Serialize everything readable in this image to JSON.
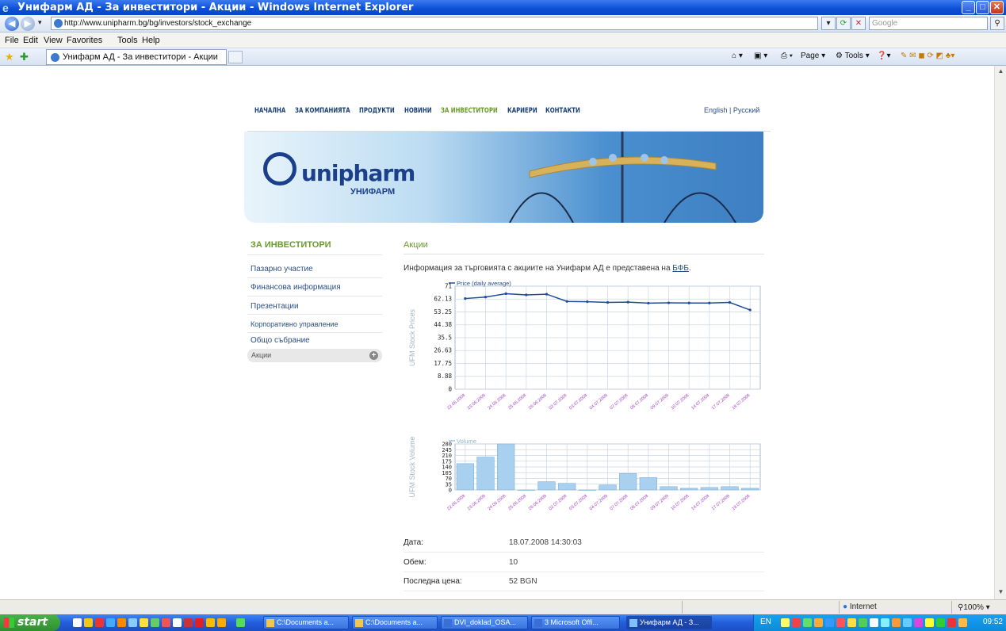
{
  "window": {
    "title": "Унифарм АД - За инвеститори - Акции - Windows Internet Explorer",
    "minimize": "_",
    "maximize": "□",
    "close": "✕"
  },
  "address": {
    "url": "http://www.unipharm.bg/bg/investors/stock_exchange",
    "search_placeholder": "Google"
  },
  "menu": [
    "File",
    "Edit",
    "View",
    "Favorites",
    "Tools",
    "Help"
  ],
  "tab": {
    "label": "Унифарм АД - За инвеститори - Акции"
  },
  "toolbar": {
    "page_label": "Page",
    "tools_label": "Tools"
  },
  "site": {
    "nav": [
      "НАЧАЛНА",
      "ЗА КОМПАНИЯТА",
      "ПРОДУКТИ",
      "НОВИНИ",
      "ЗА ИНВЕСТИТОРИ",
      "КАРИЕРИ",
      "КОНТАКТИ"
    ],
    "lang_en": "English",
    "lang_ru": "Русский",
    "logo_text": "unipharm",
    "logo_sub": "УНИФАРМ",
    "sidebar_title": "ЗА ИНВЕСТИТОРИ",
    "sidebar": [
      "Пазарно участие",
      "Финансова информация",
      "Презентации",
      "Корпоративно управление",
      "Общо събрание",
      "Акции"
    ],
    "main_title": "Акции",
    "intro": "Информация за търговията с акциите на Унифарм АД е представена на",
    "intro_link": "БФБ",
    "info": [
      {
        "label": "Дата:",
        "value": "18.07.2008 14:30:03"
      },
      {
        "label": "Обем:",
        "value": "10"
      },
      {
        "label": "Последна цена:",
        "value": "52 BGN"
      }
    ]
  },
  "chart_data": [
    {
      "type": "line",
      "legend": "Price (daily average)",
      "ylabel": "UFM Stock Prices",
      "yticks": [
        "71",
        "62.13",
        "53.25",
        "44.38",
        "35.5",
        "26.63",
        "17.75",
        "8.88",
        "0"
      ],
      "ylim": [
        0,
        71
      ],
      "categories": [
        "22.06.2008",
        "23.06.2008",
        "24.06.2008",
        "25.06.2008",
        "26.06.2008",
        "02.07.2008",
        "03.07.2008",
        "04.07.2008",
        "07.07.2008",
        "08.07.2008",
        "09.07.2008",
        "10.07.2008",
        "14.07.2008",
        "17.07.2008",
        "18.07.2008"
      ],
      "values": [
        62.5,
        63.5,
        65.8,
        65,
        65.5,
        60.5,
        60.3,
        59.8,
        60,
        59.3,
        59.5,
        59.4,
        59.4,
        59.8,
        54.6
      ]
    },
    {
      "type": "bar",
      "legend": "Volume",
      "ylabel": "UFM Stock Volume",
      "yticks": [
        "280",
        "245",
        "210",
        "175",
        "140",
        "105",
        "70",
        "35",
        "0"
      ],
      "ylim": [
        0,
        280
      ],
      "categories": [
        "22.06.2008",
        "23.06.2008",
        "24.06.2008",
        "25.06.2008",
        "26.06.2008",
        "02.07.2008",
        "03.07.2008",
        "04.07.2008",
        "07.07.2008",
        "08.07.2008",
        "09.07.2008",
        "10.07.2008",
        "14.07.2008",
        "17.07.2008",
        "18.07.2008"
      ],
      "values": [
        160,
        200,
        280,
        0,
        50,
        40,
        0,
        30,
        100,
        75,
        20,
        10,
        15,
        20,
        10
      ]
    }
  ],
  "status": {
    "zone": "Internet",
    "zoom": "100%"
  },
  "taskbar": {
    "start": "start",
    "buttons": [
      "C:\\Documents a...",
      "C:\\Documents a...",
      "DVI_doklad_OSA...",
      "3 Microsoft Offi...",
      "Унифарм АД - З..."
    ],
    "lang": "EN",
    "clock": "09:52"
  }
}
